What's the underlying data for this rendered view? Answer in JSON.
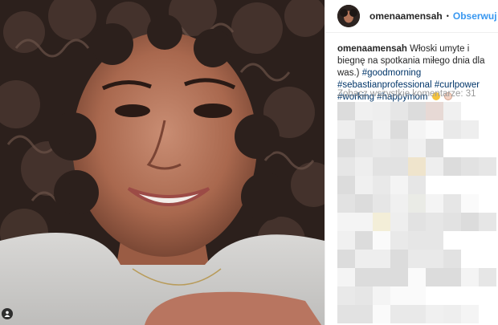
{
  "post": {
    "username": "omenaamensah",
    "separator": "•",
    "follow_label": "Obserwuj",
    "caption_user": "omenaamensah",
    "caption_text": "Włoski umyte i biegnę na spotkania miłego dnia dla was.)",
    "hashtags": "#goodmorning #sebastianprofessional #curlpower #working #happymom",
    "emojis": [
      "smiling-face-icon",
      "baby-face-icon"
    ],
    "view_all_comments": "Zobacz wszystkie komentarze: 31"
  },
  "colors": {
    "accent": "#3897f0",
    "hashtag": "#003569",
    "muted": "#999999",
    "text": "#262626"
  }
}
